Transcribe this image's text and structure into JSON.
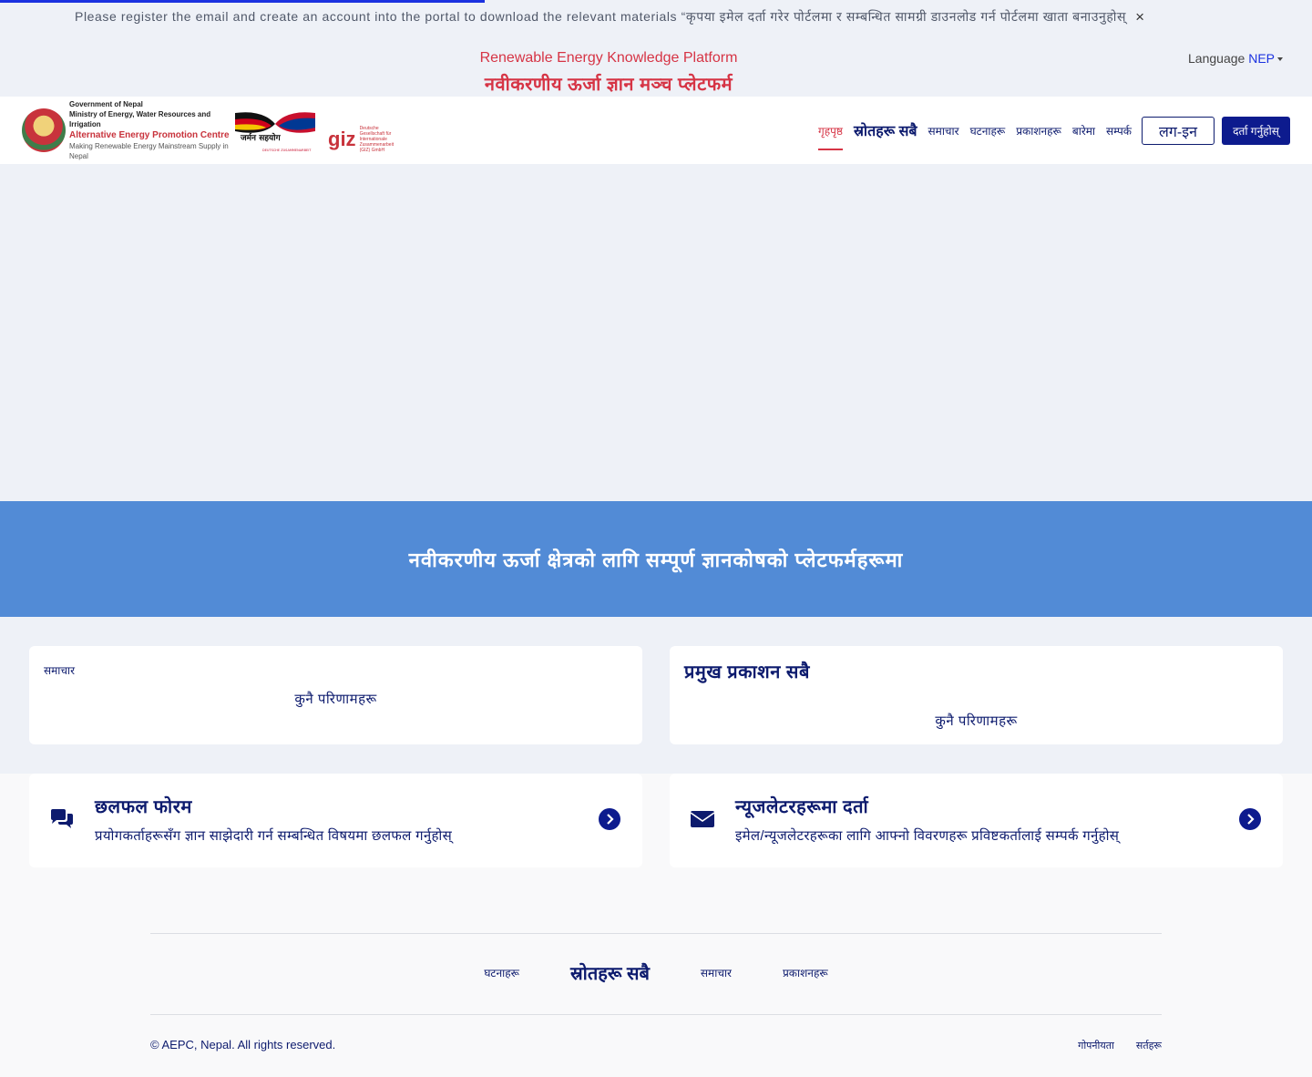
{
  "notice": {
    "text": "Please register the email and create an account into the portal to download the relevant materials “कृपया इमेल दर्ता गरेर पोर्टलमा र सम्बन्धित सामग्री डाउनलोड गर्न पोर्टलमा खाता बनाउनुहोस्",
    "close_icon": "×"
  },
  "platform": {
    "title_en": "Renewable Energy Knowledge Platform",
    "title_np": "नवीकरणीय ऊर्जा ज्ञान मञ्च प्लेटफर्म"
  },
  "language": {
    "label": "Language",
    "value": "NEP"
  },
  "logos": {
    "aepc_line1": "Government of Nepal",
    "aepc_line2": "Ministry of Energy, Water Resources and Irrigation",
    "aepc_name": "Alternative Energy Promotion Centre",
    "aepc_tagline": "Making Renewable Energy Mainstream Supply in Nepal",
    "german_coop": "जर्मन सहयोग",
    "german_sub": "DEUTSCHE ZUSAMMENARBEIT",
    "giz": "giz",
    "giz_sub": "Deutsche Gesellschaft für Internationale Zusammenarbeit (GIZ) GmbH"
  },
  "nav": {
    "items": [
      "गृहपृष्ठ",
      "स्रोतहरू सबै",
      "समाचार",
      "घटनाहरू",
      "प्रकाशनहरू",
      "बारेमा",
      "सम्पर्क"
    ],
    "login": "लग-इन",
    "register": "दर्ता गर्नुहोस्"
  },
  "banner": {
    "text": "नवीकरणीय ऊर्जा क्षेत्रको लागि सम्पूर्ण ज्ञानकोषको प्लेटफर्महरूमा"
  },
  "news": {
    "heading": "समाचार",
    "empty": "कुनै परिणामहरू"
  },
  "publications": {
    "heading": "प्रमुख प्रकाशन सबै",
    "empty": "कुनै परिणामहरू"
  },
  "features": [
    {
      "title": "छलफल फोरम",
      "desc": "प्रयोगकर्ताहरूसँग ज्ञान साझेदारी गर्न सम्बन्धित विषयमा छलफल गर्नुहोस्",
      "icon": "comments-icon"
    },
    {
      "title": "न्यूजलेटरहरूमा दर्ता",
      "desc": "इमेल/न्यूजलेटरहरूका लागि आफ्नो विवरणहरू प्रविष्टकर्तालाई सम्पर्क गर्नुहोस्",
      "icon": "envelope-icon"
    }
  ],
  "footer": {
    "nav": [
      "घटनाहरू",
      "स्रोतहरू सबै",
      "समाचार",
      "प्रकाशनहरू"
    ],
    "copyright": "© AEPC, Nepal. All rights reserved.",
    "links": [
      "गोपनीयता",
      "सर्तहरू"
    ]
  },
  "colors": {
    "primary": "#0d1b6e",
    "accent": "#d63445",
    "banner": "#528bd6",
    "button": "#0d1b8e"
  }
}
